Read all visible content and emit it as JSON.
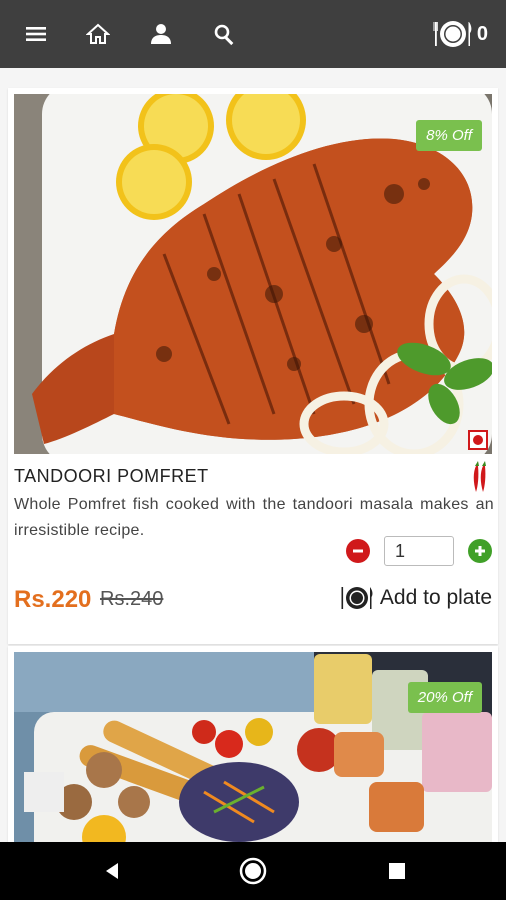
{
  "app": {
    "plate_count": "0"
  },
  "topbar": {
    "icons": [
      "menu-icon",
      "home-icon",
      "user-icon",
      "search-icon",
      "plate-icon"
    ]
  },
  "items": [
    {
      "title": "TANDOORI POMFRET",
      "description": "Whole Pomfret fish cooked with the tandoori masala makes an irresistible recipe.",
      "discount": "8% Off",
      "quantity": "1",
      "price": "Rs.220",
      "old_price": "Rs.240",
      "add_label": "Add to plate"
    },
    {
      "discount": "20% Off"
    }
  ],
  "colors": {
    "topbar": "#3f3f3f",
    "discount": "#7ac04e",
    "price": "#e36f1e",
    "minus": "#d0191b",
    "plus": "#40a028"
  }
}
